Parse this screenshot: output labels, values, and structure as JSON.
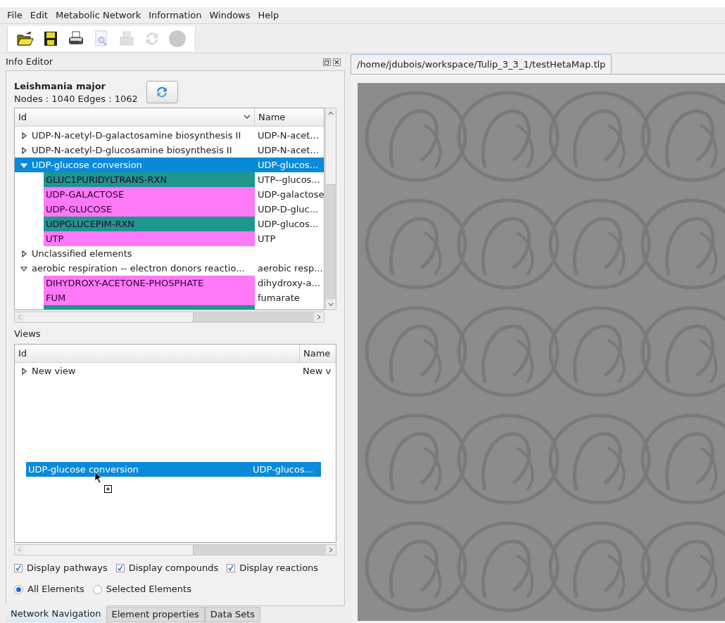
{
  "menu": [
    {
      "label": "File"
    },
    {
      "label": "Edit"
    },
    {
      "label": "Metabolic Network"
    },
    {
      "label": "Information"
    },
    {
      "label": "Windows"
    },
    {
      "label": "Help"
    }
  ],
  "toolbar": [
    {
      "kind": "open",
      "disabled": false
    },
    {
      "kind": "save",
      "disabled": false
    },
    {
      "kind": "print",
      "disabled": false
    },
    {
      "kind": "preview",
      "disabled": true
    },
    {
      "kind": "export",
      "disabled": true
    },
    {
      "kind": "refresh",
      "disabled": true
    },
    {
      "kind": "record",
      "disabled": true
    }
  ],
  "dock": {
    "title": "Info Editor",
    "graph_name": "Leishmania major",
    "stats": "Nodes : 1040 Edges : 1062"
  },
  "elements_tree": {
    "columns": [
      "Id",
      "Name"
    ],
    "rows": [
      {
        "id": "UDP-N-acetyl-D-galactosamine biosynthesis II",
        "name": "UDP-N-acet...",
        "expanded": false,
        "selected": false,
        "children": []
      },
      {
        "id": "UDP-N-acetyl-D-glucosamine biosynthesis II",
        "name": "UDP-N-acet...",
        "expanded": false,
        "selected": false,
        "children": []
      },
      {
        "id": "UDP-glucose conversion",
        "name": "UDP-glucos...",
        "expanded": true,
        "selected": true,
        "children": [
          {
            "id": "GLUC1PURIDYLTRANS-RXN",
            "name": "UTP--glucos...",
            "color": "#1f968e"
          },
          {
            "id": "UDP-GALACTOSE",
            "name": "UDP-galactose",
            "color": "#ff78f8"
          },
          {
            "id": "UDP-GLUCOSE",
            "name": "UDP-D-gluc...",
            "color": "#ff78f8"
          },
          {
            "id": "UDPGLUCEPIM-RXN",
            "name": "UDP-glucos...",
            "color": "#1f968e"
          },
          {
            "id": "UTP",
            "name": "UTP",
            "color": "#ff78f8"
          }
        ]
      },
      {
        "id": "Unclassified elements",
        "name": "",
        "expanded": false,
        "selected": false,
        "children": []
      },
      {
        "id": "aerobic respiration -- electron donors reactio...",
        "name": "aerobic resp...",
        "expanded": true,
        "selected": false,
        "children": [
          {
            "id": "DIHYDROXY-ACETONE-PHOSPHATE",
            "name": "dihydroxy-a...",
            "color": "#ff78f8"
          },
          {
            "id": "FUM",
            "name": "fumarate",
            "color": "#ff78f8"
          }
        ]
      }
    ]
  },
  "views": {
    "title": "Views",
    "columns": [
      "Id",
      "Name"
    ],
    "rows": [
      {
        "id": "New view",
        "name": "New v",
        "expanded": false
      }
    ],
    "drag_item": {
      "id": "UDP-glucose conversion",
      "name": "UDP-glucos..."
    }
  },
  "display_options": [
    {
      "label": "Display pathways",
      "checked": true
    },
    {
      "label": "Display compounds",
      "checked": true
    },
    {
      "label": "Display reactions",
      "checked": true
    }
  ],
  "scope": [
    {
      "label": "All Elements",
      "selected": true
    },
    {
      "label": "Selected Elements",
      "selected": false
    }
  ],
  "bottom_tabs": [
    {
      "label": "Network Navigation",
      "selected": true
    },
    {
      "label": "Element properties",
      "selected": false
    },
    {
      "label": "Data Sets",
      "selected": false
    }
  ],
  "document_tab": {
    "label": "/home/jdubois/workspace/Tulip_3_3_1/testHetaMap.tlp"
  }
}
